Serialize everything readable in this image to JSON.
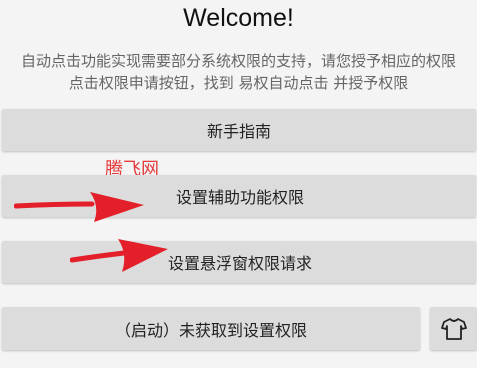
{
  "header": {
    "title": "Welcome!",
    "description_line1": "自动点击功能实现需要部分系统权限的支持，请您授予相应的权限",
    "description_line2": "点击权限申请按钮，找到 易权自动点击 并授予权限"
  },
  "buttons": {
    "guide": "新手指南",
    "accessibility": "设置辅助功能权限",
    "overlay": "设置悬浮窗权限请求",
    "start": "（启动）未获取到设置权限"
  },
  "watermark": "腾飞网",
  "icons": {
    "shirt_button": "t-shirt-icon",
    "arrows": "red-arrow-icon"
  },
  "colors": {
    "button_bg": "#dcdcdc",
    "page_bg": "#f4f4f4",
    "annotation_red": "#e3202a"
  }
}
